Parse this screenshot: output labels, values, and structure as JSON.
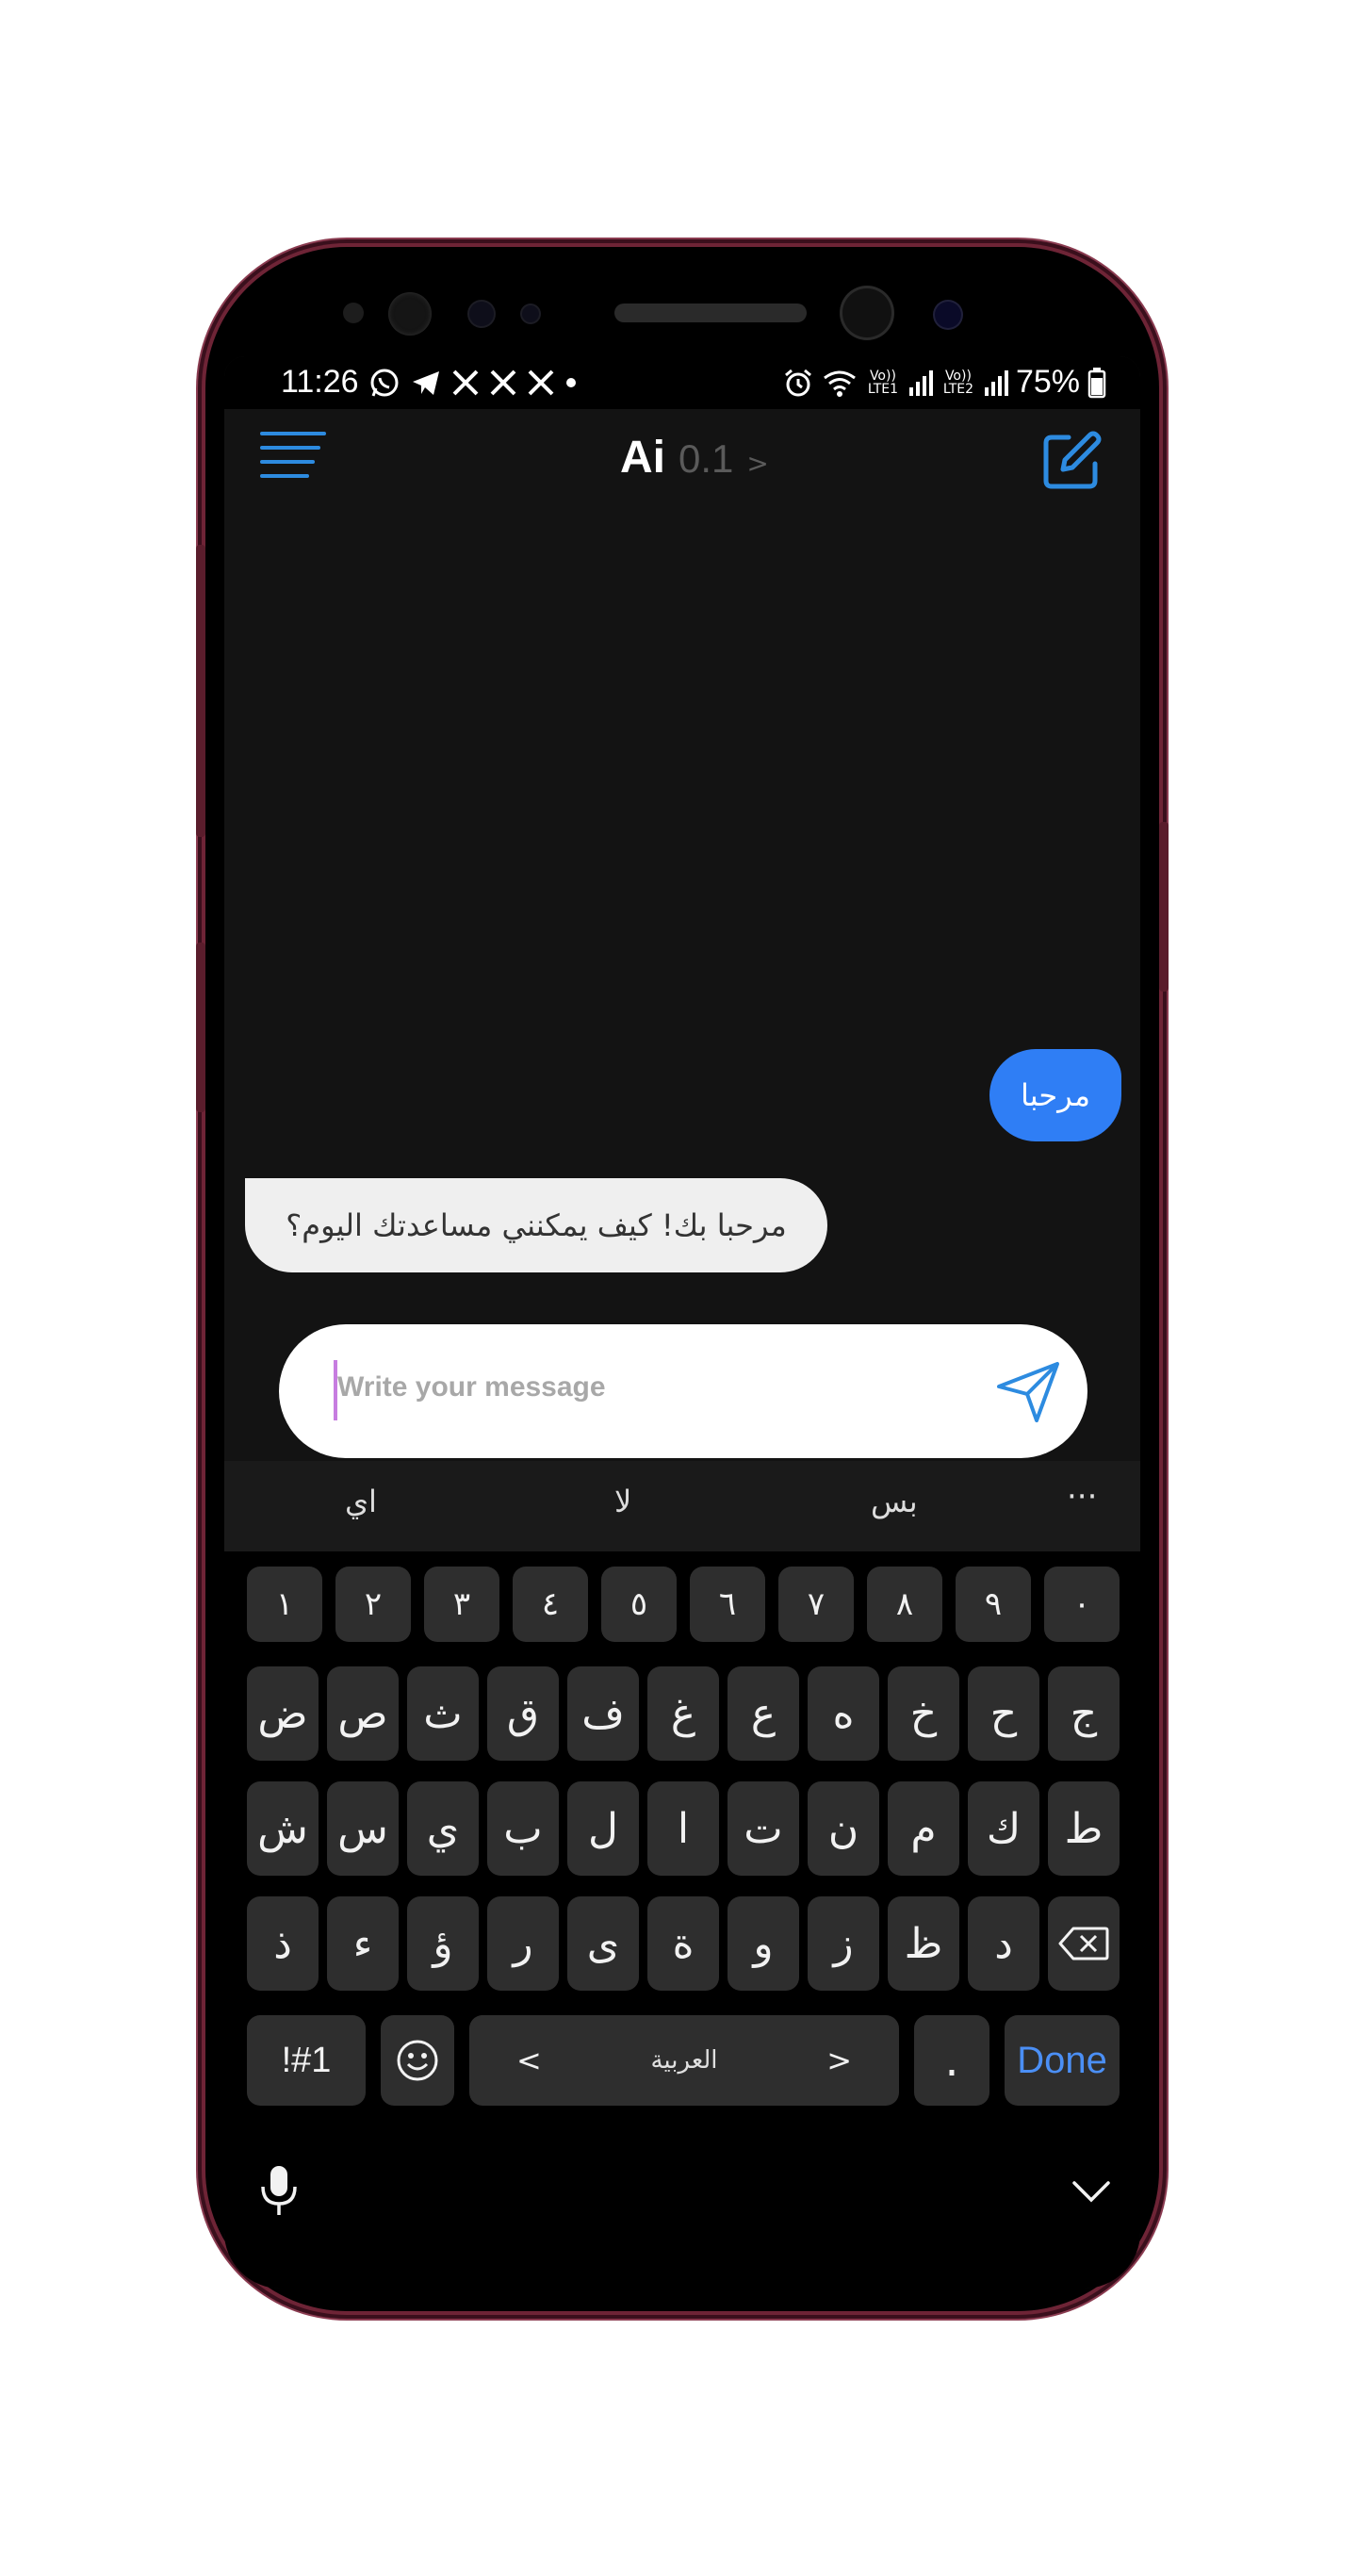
{
  "status_bar": {
    "time": "11:26",
    "left_icons": [
      "whatsapp-icon",
      "telegram-icon",
      "x-icon",
      "x-icon",
      "x-icon",
      "dot-icon"
    ],
    "right_icons": [
      "alarm-icon",
      "wifi-icon",
      "volte-lte1-icon",
      "signal-icon",
      "volte-lte2-icon",
      "signal-icon",
      "battery-icon"
    ],
    "sim1_label": "Vo)) LTE1",
    "sim2_label": "Vo)) LTE2",
    "battery": "75%"
  },
  "header": {
    "title": "Ai",
    "version": "0.1",
    "chevron": ">",
    "menu_icon": "menu-icon",
    "edit_icon": "edit-icon",
    "accent": "#2d8be0"
  },
  "messages": [
    {
      "role": "user",
      "text": "مرحبا"
    },
    {
      "role": "assistant",
      "text": "مرحبا بك! كيف يمكنني مساعدتك اليوم؟"
    }
  ],
  "composer": {
    "placeholder": "Write your message",
    "send_icon": "send-icon"
  },
  "keyboard": {
    "suggestions": [
      "اي",
      "لا",
      "بس"
    ],
    "more": "···",
    "number_row": [
      "١",
      "٢",
      "٣",
      "٤",
      "٥",
      "٦",
      "٧",
      "٨",
      "٩",
      "٠"
    ],
    "row1": [
      "ض",
      "ص",
      "ث",
      "ق",
      "ف",
      "غ",
      "ع",
      "ه",
      "خ",
      "ح",
      "ج"
    ],
    "row2": [
      "ش",
      "س",
      "ي",
      "ب",
      "ل",
      "ا",
      "ت",
      "ن",
      "م",
      "ك",
      "ط"
    ],
    "row3": [
      "ذ",
      "ء",
      "ؤ",
      "ر",
      "ى",
      "ة",
      "و",
      "ز",
      "ظ",
      "د"
    ],
    "symbols_key": "!#1",
    "space_label": "العربية",
    "space_left": "<",
    "space_right": ">",
    "period_key": ".",
    "done_key": "Done",
    "done_color": "#4b8ff5",
    "mic_icon": "mic-icon",
    "hide_icon": "chevron-down-icon"
  }
}
